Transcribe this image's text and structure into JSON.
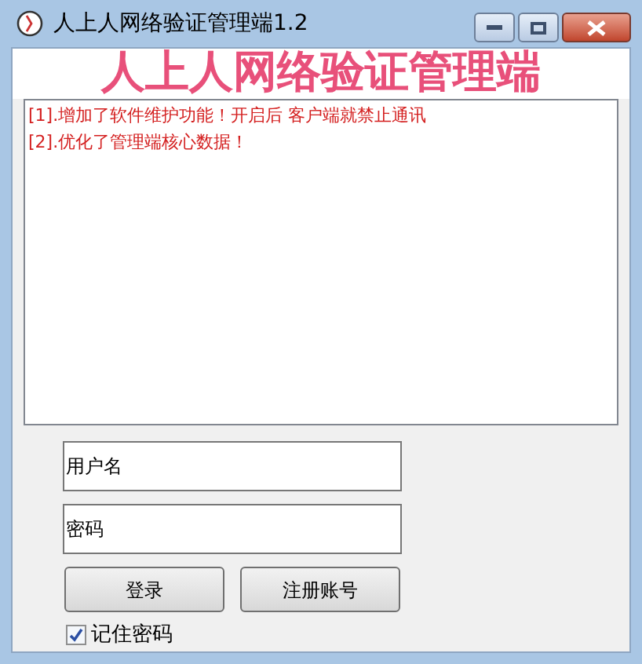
{
  "window": {
    "title": "人上人网络验证管理端1.2",
    "buttons": [
      {
        "kind": "minimize"
      },
      {
        "kind": "maximize"
      },
      {
        "kind": "close"
      }
    ]
  },
  "heading": "人上人网络验证管理端",
  "log": [
    "[1].增加了软件维护功能！开启后 客户端就禁止通讯",
    "[2].优化了管理端核心数据！"
  ],
  "username": {
    "value": "用户名"
  },
  "password": {
    "value": "密码"
  },
  "buttons": [
    "登录",
    "注册账号"
  ],
  "remember": {
    "label": "记住密码",
    "checked": true
  }
}
